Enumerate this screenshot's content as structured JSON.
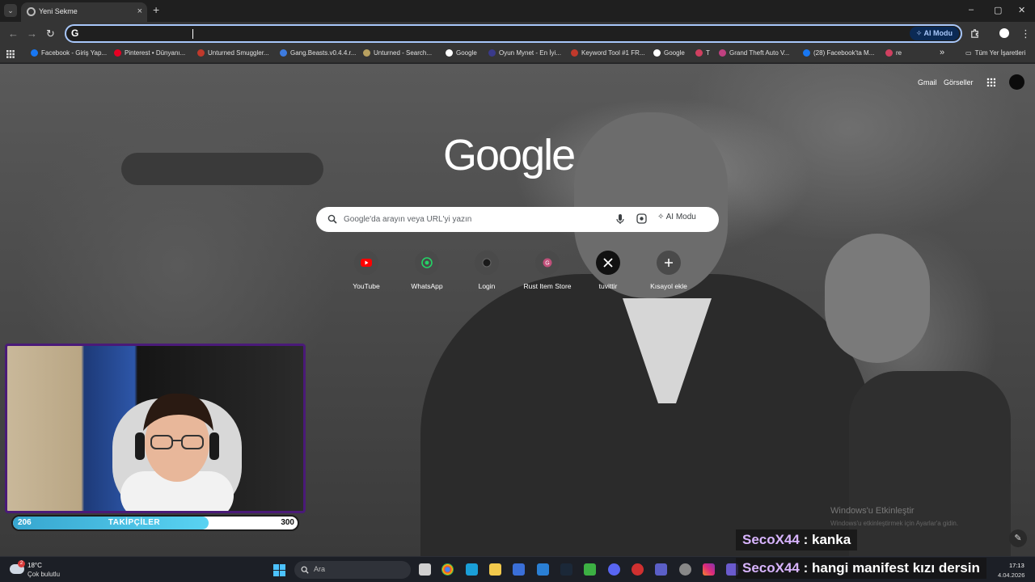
{
  "browser": {
    "tab_title": "Yeni Sekme",
    "tab_close": "×",
    "new_tab": "+",
    "window_minimize": "–",
    "window_maximize": "▢",
    "window_close": "✕",
    "omnibox_ai_label": "AI Modu"
  },
  "bookmarks": {
    "items": [
      {
        "label": "Facebook - Giriş Yap...",
        "color": "#1877f2"
      },
      {
        "label": "Pinterest • Dünyanı...",
        "color": "#e60023"
      },
      {
        "label": "Unturned Smuggler...",
        "color": "#c0392b"
      },
      {
        "label": "Gang.Beasts.v0.4.4.r...",
        "color": "#3d7be0"
      },
      {
        "label": "Unturned - Search...",
        "color": "#b8a060"
      },
      {
        "label": "Google",
        "color": "#ffffff"
      },
      {
        "label": "Oyun Mynet - En İyi...",
        "color": "#3a3a8a"
      },
      {
        "label": "Keyword Tool #1 FR...",
        "color": "#c0392b"
      },
      {
        "label": "Google",
        "color": "#ffffff"
      },
      {
        "label": "T",
        "color": "#d04060"
      },
      {
        "label": "Grand Theft Auto V...",
        "color": "#c04080"
      },
      {
        "label": "(28) Facebook'ta M...",
        "color": "#1877f2"
      },
      {
        "label": "re",
        "color": "#d04060"
      }
    ],
    "more": "»",
    "all_bookmarks": "Tüm Yer İşaretleri"
  },
  "ntp": {
    "gmail": "Gmail",
    "images": "Görseller",
    "logo": "Google",
    "search_placeholder": "Google'da arayın veya URL'yi yazın",
    "ai_mode": "AI Modu",
    "shortcuts": [
      {
        "label": "YouTube",
        "icon": "youtube-icon"
      },
      {
        "label": "WhatsApp",
        "icon": "whatsapp-icon"
      },
      {
        "label": "Login",
        "icon": "login-icon"
      },
      {
        "label": "Rust Item Store",
        "icon": "rust-icon"
      },
      {
        "label": "tuvittir",
        "icon": "x-icon"
      },
      {
        "label": "Kısayol ekle",
        "icon": "plus-icon"
      }
    ]
  },
  "watermark": {
    "title": "Windows'u Etkinleştir",
    "subtitle": "Windows'u etkinleştirmek için Ayarlar'a gidin."
  },
  "overlay": {
    "followers_current": "206",
    "followers_title": "TAKİPÇİLER",
    "followers_goal": "300",
    "followers_progress": 0.687,
    "chat": [
      {
        "user": "SecoX44",
        "message": ": kanka"
      },
      {
        "user": "SecoX44",
        "message": ": hangi manifest kızı dersin"
      }
    ]
  },
  "taskbar": {
    "weather_badge": "2",
    "temperature": "18°C",
    "condition": "Çok bulutlu",
    "search_label": "Ara",
    "time": "17:13",
    "date": "4.04.2026"
  }
}
